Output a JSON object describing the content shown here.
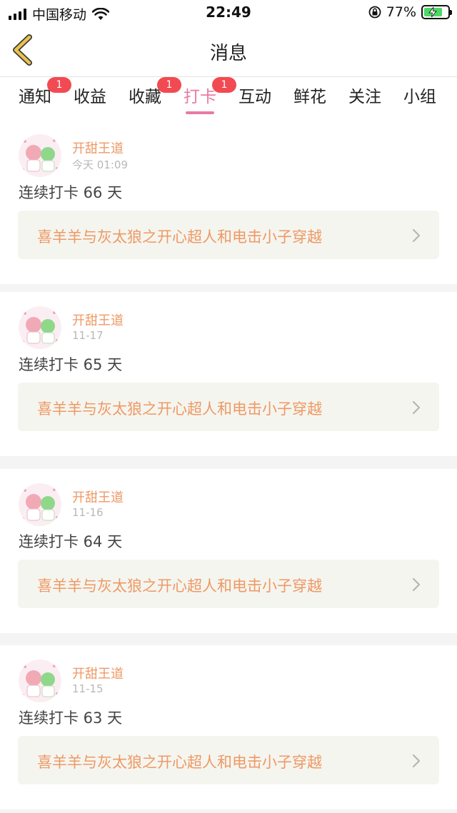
{
  "status_bar": {
    "carrier": "中国移动",
    "time": "22:49",
    "battery_percent": "77%",
    "battery_level": 0.77
  },
  "nav": {
    "title": "消息"
  },
  "tabs": [
    {
      "label": "通知",
      "badge": "1",
      "active": false
    },
    {
      "label": "收益",
      "badge": "",
      "active": false
    },
    {
      "label": "收藏",
      "badge": "1",
      "active": false
    },
    {
      "label": "打卡",
      "badge": "1",
      "active": true
    },
    {
      "label": "互动",
      "badge": "",
      "active": false
    },
    {
      "label": "鲜花",
      "badge": "",
      "active": false
    },
    {
      "label": "关注",
      "badge": "",
      "active": false
    },
    {
      "label": "小组",
      "badge": "",
      "active": false
    }
  ],
  "items": [
    {
      "author": "开甜王道",
      "time": "今天 01:09",
      "text": "连续打卡 66 天",
      "book": "喜羊羊与灰太狼之开心超人和电击小子穿越"
    },
    {
      "author": "开甜王道",
      "time": "11-17",
      "text": "连续打卡 65 天",
      "book": "喜羊羊与灰太狼之开心超人和电击小子穿越"
    },
    {
      "author": "开甜王道",
      "time": "11-16",
      "text": "连续打卡 64 天",
      "book": "喜羊羊与灰太狼之开心超人和电击小子穿越"
    },
    {
      "author": "开甜王道",
      "time": "11-15",
      "text": "连续打卡 63 天",
      "book": "喜羊羊与灰太狼之开心超人和电击小子穿越"
    }
  ],
  "colors": {
    "accent_pink": "#e87aa4",
    "accent_orange": "#ee9965",
    "badge_red": "#f24a52",
    "back_arrow": "#e9c44d"
  },
  "icons": {
    "back": "chevron-left-icon",
    "item_link": "chevron-right-icon",
    "wifi": "wifi-icon",
    "lock": "rotation-lock-icon"
  }
}
